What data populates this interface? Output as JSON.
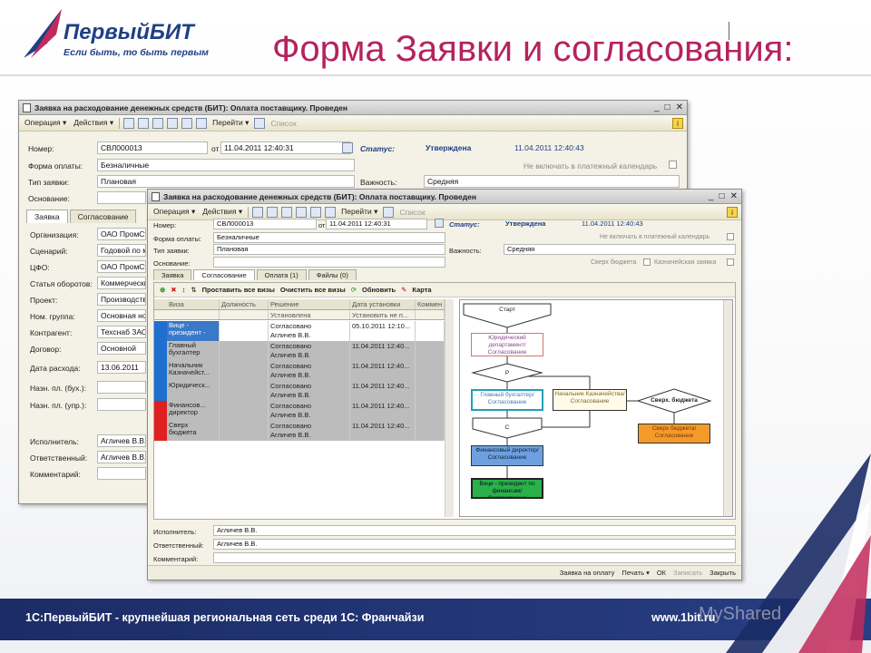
{
  "logo": {
    "name": "ПервыйБИТ",
    "slogan": "Если быть, то быть первым"
  },
  "slide_title": "Форма Заявки и согласования:",
  "footer": {
    "text": "1С:ПервыйБИТ - крупнейшая региональная сеть среди 1С: Франчайзи",
    "url": "www.1bit.ru"
  },
  "watermark": "MyShared",
  "back_window": {
    "title": "Заявка на расходование денежных средств (БИТ): Оплата поставщику. Проведен",
    "toolbar": {
      "operation": "Операция ▾",
      "actions": "Действия ▾",
      "goto": "Перейти ▾",
      "list": "Список"
    },
    "fields": {
      "number_label": "Номер:",
      "number": "СВЛ000013",
      "from_label": "от",
      "date": "11.04.2011 12:40:31",
      "status_label": "Статус:",
      "status": "Утверждена",
      "status_date": "11.04.2011 12:40:43",
      "pay_form_label": "Форма оплаты:",
      "pay_form": "Безналичные",
      "exclude_label": "Не включать в платежный календарь",
      "type_label": "Тип заявки:",
      "type": "Плановая",
      "importance_label": "Важность:",
      "importance": "Средняя",
      "basis_label": "Основание:"
    },
    "tabs": [
      "Заявка",
      "Согласование"
    ],
    "rows": [
      {
        "label": "Организация:",
        "value": "ОАО ПромСт"
      },
      {
        "label": "Сценарий:",
        "value": "Годовой по м"
      },
      {
        "label": "ЦФО:",
        "value": "ОАО ПромСт"
      },
      {
        "label": "Статья оборотов:",
        "value": "Коммерчески"
      },
      {
        "label": "Проект:",
        "value": "Производств"
      },
      {
        "label": "Ном. группа:",
        "value": "Основная но"
      },
      {
        "label": "Контрагент:",
        "value": "Техснаб ЗАО"
      },
      {
        "label": "Договор:",
        "value": "Основной"
      },
      {
        "label": "Дата расхода:",
        "value": "13.06.2011"
      },
      {
        "label": "Назн. пл. (бух.):",
        "value": ""
      },
      {
        "label": "Назн. пл. (упр.):",
        "value": ""
      }
    ],
    "bottom_rows": [
      {
        "label": "Исполнитель:",
        "value": "Агличев В.В."
      },
      {
        "label": "Ответственный:",
        "value": "Агличев В.В."
      },
      {
        "label": "Комментарий:",
        "value": ""
      }
    ]
  },
  "front_window": {
    "title": "Заявка на расходование денежных средств (БИТ): Оплата поставщику. Проведен",
    "toolbar": {
      "operation": "Операция ▾",
      "actions": "Действия ▾",
      "goto": "Перейти ▾",
      "list": "Список"
    },
    "fields": {
      "number_label": "Номер:",
      "number": "СВЛ000013",
      "from_label": "от",
      "date": "11.04.2011 12:40:31",
      "status_label": "Статус:",
      "status": "Утверждена",
      "status_date": "11.04.2011 12:40:43",
      "pay_form_label": "Форма оплаты:",
      "pay_form": "Безналичные",
      "exclude_label": "Не включать в платежный календарь",
      "type_label": "Тип заявки:",
      "type": "Плановая",
      "importance_label": "Важность:",
      "importance": "Средняя",
      "basis_label": "Основание:",
      "over_budget_label": "Сверх бюджета",
      "treasury_label": "Казначейская заявка"
    },
    "tabs": [
      "Заявка",
      "Согласование",
      "Оплата (1)",
      "Файлы (0)"
    ],
    "approval_toolbar": {
      "set_all": "Проставить все визы",
      "clear_all": "Очистить все визы",
      "refresh": "Обновить",
      "map": "Карта"
    },
    "grid": {
      "headers": [
        "Виза",
        "Должность",
        "Решение",
        "Дата установки",
        "Коммен"
      ],
      "subheaders": [
        "",
        "",
        "Установлена",
        "Установить не п...",
        ""
      ],
      "rows": [
        {
          "viza": "Вице - президент -",
          "decision": "Согласовано",
          "who": "Агличев В.В.",
          "date": "05.10.2011 12:10...",
          "color": "#1f6fd0"
        },
        {
          "viza": "Главный бухгалтер",
          "decision": "Согласовано",
          "who": "Агличев В.В.",
          "date": "11.04.2011 12:40...",
          "color": "#1f6fd0"
        },
        {
          "viza": "Начальник Казначейст...",
          "decision": "Согласовано",
          "who": "Агличев В.В.",
          "date": "11.04.2011 12:40...",
          "color": "#1f6fd0"
        },
        {
          "viza": "Юридическ...",
          "decision": "Согласовано",
          "who": "Агличев В.В.",
          "date": "11.04.2011 12:40...",
          "color": "#1f6fd0"
        },
        {
          "viza": "Финансов... директор",
          "decision": "Согласовано",
          "who": "Агличев В.В.",
          "date": "11.04.2011 12:40...",
          "color": "#e02020"
        },
        {
          "viza": "Сверх бюджета",
          "decision": "Согласовано",
          "who": "Агличев В.В.",
          "date": "11.04.2011 12:40...",
          "color": "#e02020"
        }
      ]
    },
    "flow": {
      "start": "Старт",
      "legal": "Юридический департамент/Согласование",
      "p": "Р",
      "chief_acc": "Главный бухгалтер/Согласование",
      "treasury": "Начальник Казначейства/Согласование",
      "over_budget": "Сверх. бюджета",
      "over_budget_box": "Сверх бюджета/Согласование",
      "c": "С",
      "fin_dir": "Финансовый директор/Согласование",
      "vp": "Вице - президент по финансам/Согласование"
    },
    "bottom_rows": [
      {
        "label": "Исполнитель:",
        "value": "Агличев В.В."
      },
      {
        "label": "Ответственный:",
        "value": "Агличев В.В."
      },
      {
        "label": "Комментарий:",
        "value": ""
      }
    ],
    "bottom_buttons": [
      "Заявка на оплату",
      "Печать ▾",
      "ОК",
      "Записать",
      "Закрыть"
    ]
  }
}
